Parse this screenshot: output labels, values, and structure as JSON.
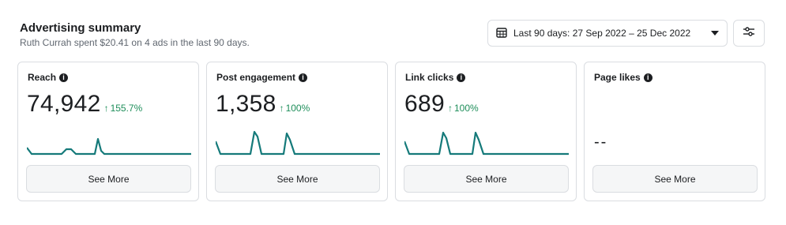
{
  "header": {
    "title": "Advertising summary",
    "subtitle": "Ruth Currah spent $20.41 on 4 ads in the last 90 days."
  },
  "date_range": {
    "label": "Last 90 days: 27 Sep 2022 – 25 Dec 2022",
    "icon": "calendar-icon"
  },
  "filter": {
    "icon": "settings-sliders-icon"
  },
  "cards": [
    {
      "label": "Reach",
      "value": "74,942",
      "change": "155.7%",
      "button": "See More"
    },
    {
      "label": "Post engagement",
      "value": "1,358",
      "change": "100%",
      "button": "See More"
    },
    {
      "label": "Link clicks",
      "value": "689",
      "change": "100%",
      "button": "See More"
    },
    {
      "label": "Page likes",
      "value": "--",
      "change": "",
      "button": "See More"
    }
  ],
  "colors": {
    "accent_line": "#157a7a",
    "positive": "#1e8e5a"
  }
}
